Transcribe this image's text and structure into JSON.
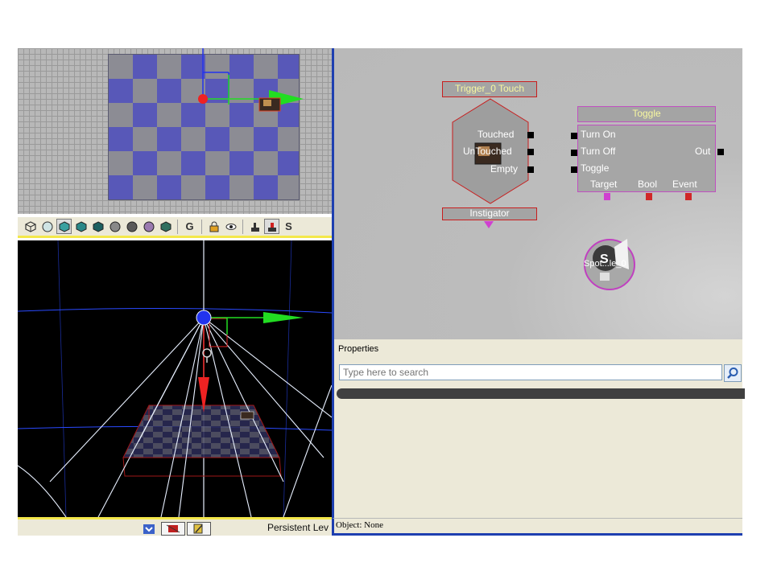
{
  "toolbar": {
    "buttons": [
      "wireframe-cube",
      "cylinder",
      "unlit-cube",
      "lit-cube",
      "brush-cube",
      "camera-sphere",
      "lighting",
      "texture",
      "realtime",
      "grid",
      "lock",
      "eye",
      "actor",
      "actor-red",
      "sprite"
    ],
    "g_label": "G",
    "s_label": "S"
  },
  "statusbar": {
    "level_name": "Persistent Lev"
  },
  "kismet": {
    "trigger_node": {
      "title": "Trigger_0 Touch",
      "outputs": [
        "Touched",
        "UnTouched",
        "Empty"
      ],
      "var_link": "Instigator",
      "var_link_color": "#d040d0"
    },
    "toggle_node": {
      "title": "Toggle",
      "inputs": [
        "Turn On",
        "Turn Off",
        "Toggle"
      ],
      "output": "Out",
      "var_links": [
        "Target",
        "Bool",
        "Event"
      ],
      "border_color": "#c050c0"
    },
    "spotlight_var": {
      "label": "Spot...le_0",
      "icon_letter": "S"
    }
  },
  "properties": {
    "title": "Properties",
    "search_placeholder": "Type here to search"
  },
  "object_status": "Object: None",
  "colors": {
    "viewport_border": "#f4e84a",
    "panel_divider": "#1e3fb0",
    "node_border": "#c81e1e",
    "node_title_text": "#f8f8a0",
    "gizmo_x": "#22dd22",
    "gizmo_y": "#ee2222",
    "gizmo_z": "#2233ee"
  }
}
